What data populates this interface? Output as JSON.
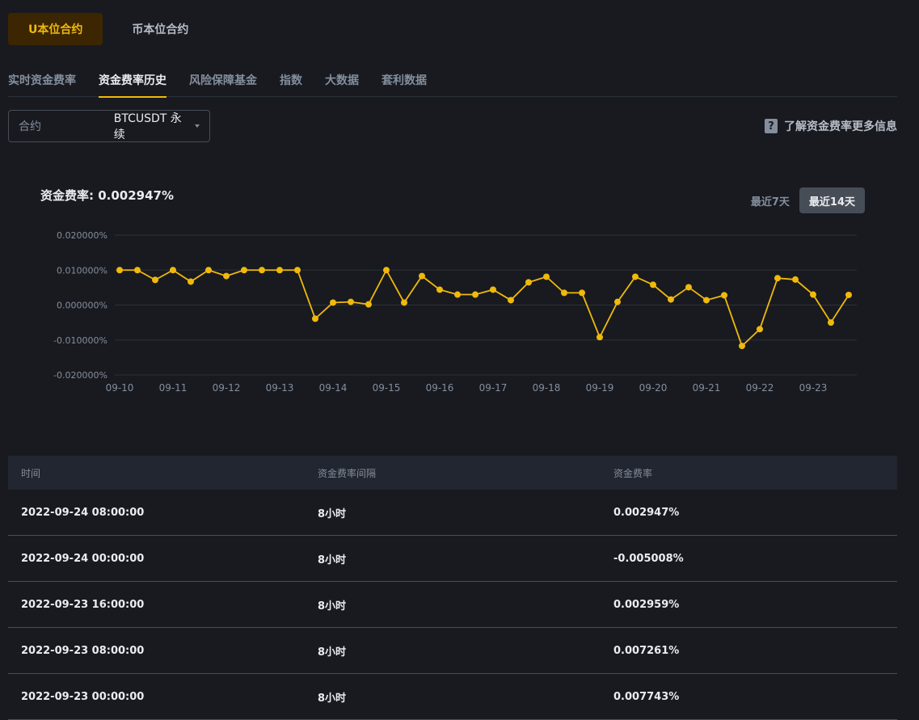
{
  "top_tabs": {
    "usdt": "U本位合约",
    "coin": "币本位合约"
  },
  "sub_nav": [
    "实时资金费率",
    "资金费率历史",
    "风险保障基金",
    "指数",
    "大数据",
    "套利数据"
  ],
  "contract": {
    "label": "合约",
    "value": "BTCUSDT 永续"
  },
  "info_link": "了解资金费率更多信息",
  "rate_title": "资金费率: 0.002947%",
  "range": {
    "seven": "最近7天",
    "fourteen": "最近14天"
  },
  "colors": {
    "accent": "#f0b90b",
    "line": "#f0b90b"
  },
  "chart_data": {
    "type": "line",
    "x": [
      "09-10",
      "09-11",
      "09-12",
      "09-13",
      "09-14",
      "09-15",
      "09-16",
      "09-17",
      "09-18",
      "09-19",
      "09-20",
      "09-21",
      "09-22",
      "09-23"
    ],
    "series": [
      {
        "values": [
          0.01,
          0.01,
          0.0072,
          0.01,
          0.0067,
          0.01,
          0.0083,
          0.01,
          0.01,
          0.01,
          0.01,
          -0.0039,
          0.0007,
          0.0009,
          0.0002,
          0.01,
          0.0007,
          0.0083,
          0.0044,
          0.003,
          0.003,
          0.0044,
          0.0014,
          0.0065,
          0.0081,
          0.0035,
          0.0035,
          -0.0092,
          0.0009,
          0.0081,
          0.0058,
          0.0016,
          0.0051,
          0.0014,
          0.0028,
          -0.0117,
          -0.0069,
          0.0077,
          0.0073,
          0.003,
          -0.005,
          0.0029
        ]
      }
    ],
    "y_ticks": [
      "0.020000%",
      "0.010000%",
      "0.000000%",
      "-0.010000%",
      "-0.020000%"
    ],
    "ylim": [
      -0.02,
      0.02
    ],
    "grid": true
  },
  "table": {
    "headers": [
      "时间",
      "资金费率间隔",
      "资金费率"
    ],
    "rows": [
      [
        "2022-09-24 08:00:00",
        "8小时",
        "0.002947%"
      ],
      [
        "2022-09-24 00:00:00",
        "8小时",
        "-0.005008%"
      ],
      [
        "2022-09-23 16:00:00",
        "8小时",
        "0.002959%"
      ],
      [
        "2022-09-23 08:00:00",
        "8小时",
        "0.007261%"
      ],
      [
        "2022-09-23 00:00:00",
        "8小时",
        "0.007743%"
      ]
    ]
  }
}
